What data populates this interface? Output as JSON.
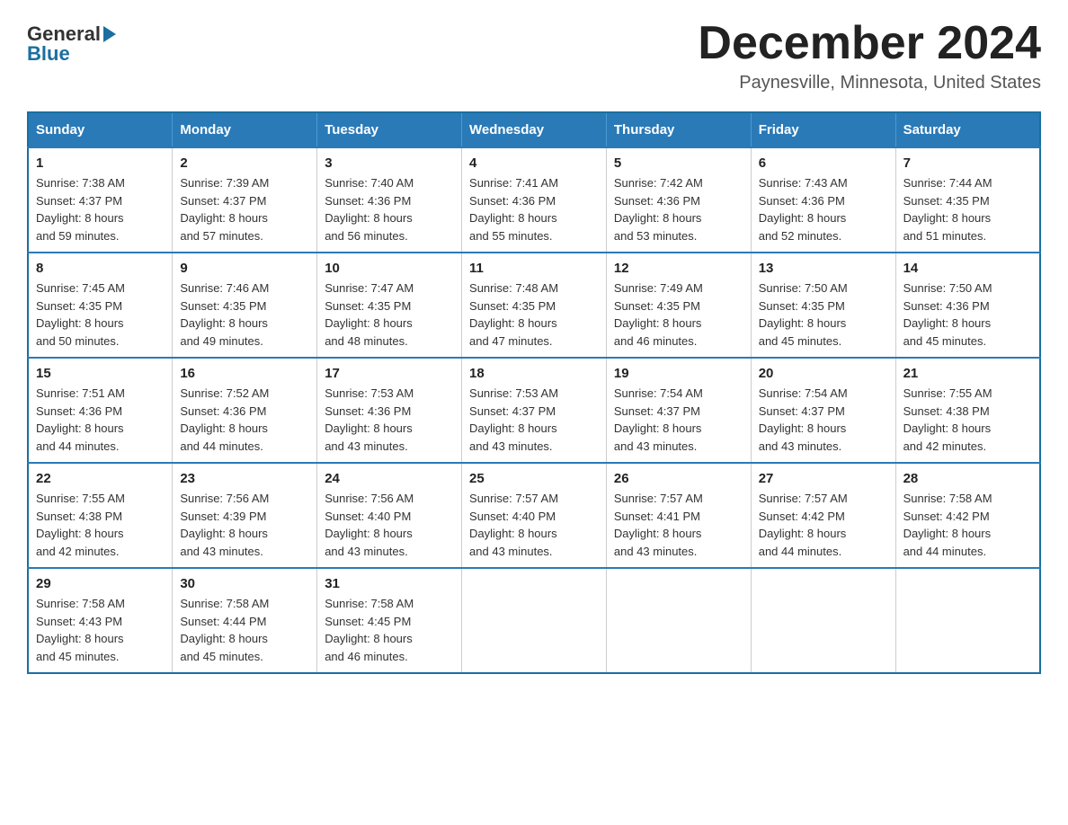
{
  "logo": {
    "general": "General",
    "blue": "Blue"
  },
  "title": "December 2024",
  "subtitle": "Paynesville, Minnesota, United States",
  "days_header": [
    "Sunday",
    "Monday",
    "Tuesday",
    "Wednesday",
    "Thursday",
    "Friday",
    "Saturday"
  ],
  "weeks": [
    [
      {
        "num": "1",
        "sunrise": "7:38 AM",
        "sunset": "4:37 PM",
        "daylight": "8 hours and 59 minutes."
      },
      {
        "num": "2",
        "sunrise": "7:39 AM",
        "sunset": "4:37 PM",
        "daylight": "8 hours and 57 minutes."
      },
      {
        "num": "3",
        "sunrise": "7:40 AM",
        "sunset": "4:36 PM",
        "daylight": "8 hours and 56 minutes."
      },
      {
        "num": "4",
        "sunrise": "7:41 AM",
        "sunset": "4:36 PM",
        "daylight": "8 hours and 55 minutes."
      },
      {
        "num": "5",
        "sunrise": "7:42 AM",
        "sunset": "4:36 PM",
        "daylight": "8 hours and 53 minutes."
      },
      {
        "num": "6",
        "sunrise": "7:43 AM",
        "sunset": "4:36 PM",
        "daylight": "8 hours and 52 minutes."
      },
      {
        "num": "7",
        "sunrise": "7:44 AM",
        "sunset": "4:35 PM",
        "daylight": "8 hours and 51 minutes."
      }
    ],
    [
      {
        "num": "8",
        "sunrise": "7:45 AM",
        "sunset": "4:35 PM",
        "daylight": "8 hours and 50 minutes."
      },
      {
        "num": "9",
        "sunrise": "7:46 AM",
        "sunset": "4:35 PM",
        "daylight": "8 hours and 49 minutes."
      },
      {
        "num": "10",
        "sunrise": "7:47 AM",
        "sunset": "4:35 PM",
        "daylight": "8 hours and 48 minutes."
      },
      {
        "num": "11",
        "sunrise": "7:48 AM",
        "sunset": "4:35 PM",
        "daylight": "8 hours and 47 minutes."
      },
      {
        "num": "12",
        "sunrise": "7:49 AM",
        "sunset": "4:35 PM",
        "daylight": "8 hours and 46 minutes."
      },
      {
        "num": "13",
        "sunrise": "7:50 AM",
        "sunset": "4:35 PM",
        "daylight": "8 hours and 45 minutes."
      },
      {
        "num": "14",
        "sunrise": "7:50 AM",
        "sunset": "4:36 PM",
        "daylight": "8 hours and 45 minutes."
      }
    ],
    [
      {
        "num": "15",
        "sunrise": "7:51 AM",
        "sunset": "4:36 PM",
        "daylight": "8 hours and 44 minutes."
      },
      {
        "num": "16",
        "sunrise": "7:52 AM",
        "sunset": "4:36 PM",
        "daylight": "8 hours and 44 minutes."
      },
      {
        "num": "17",
        "sunrise": "7:53 AM",
        "sunset": "4:36 PM",
        "daylight": "8 hours and 43 minutes."
      },
      {
        "num": "18",
        "sunrise": "7:53 AM",
        "sunset": "4:37 PM",
        "daylight": "8 hours and 43 minutes."
      },
      {
        "num": "19",
        "sunrise": "7:54 AM",
        "sunset": "4:37 PM",
        "daylight": "8 hours and 43 minutes."
      },
      {
        "num": "20",
        "sunrise": "7:54 AM",
        "sunset": "4:37 PM",
        "daylight": "8 hours and 43 minutes."
      },
      {
        "num": "21",
        "sunrise": "7:55 AM",
        "sunset": "4:38 PM",
        "daylight": "8 hours and 42 minutes."
      }
    ],
    [
      {
        "num": "22",
        "sunrise": "7:55 AM",
        "sunset": "4:38 PM",
        "daylight": "8 hours and 42 minutes."
      },
      {
        "num": "23",
        "sunrise": "7:56 AM",
        "sunset": "4:39 PM",
        "daylight": "8 hours and 43 minutes."
      },
      {
        "num": "24",
        "sunrise": "7:56 AM",
        "sunset": "4:40 PM",
        "daylight": "8 hours and 43 minutes."
      },
      {
        "num": "25",
        "sunrise": "7:57 AM",
        "sunset": "4:40 PM",
        "daylight": "8 hours and 43 minutes."
      },
      {
        "num": "26",
        "sunrise": "7:57 AM",
        "sunset": "4:41 PM",
        "daylight": "8 hours and 43 minutes."
      },
      {
        "num": "27",
        "sunrise": "7:57 AM",
        "sunset": "4:42 PM",
        "daylight": "8 hours and 44 minutes."
      },
      {
        "num": "28",
        "sunrise": "7:58 AM",
        "sunset": "4:42 PM",
        "daylight": "8 hours and 44 minutes."
      }
    ],
    [
      {
        "num": "29",
        "sunrise": "7:58 AM",
        "sunset": "4:43 PM",
        "daylight": "8 hours and 45 minutes."
      },
      {
        "num": "30",
        "sunrise": "7:58 AM",
        "sunset": "4:44 PM",
        "daylight": "8 hours and 45 minutes."
      },
      {
        "num": "31",
        "sunrise": "7:58 AM",
        "sunset": "4:45 PM",
        "daylight": "8 hours and 46 minutes."
      },
      null,
      null,
      null,
      null
    ]
  ],
  "labels": {
    "sunrise": "Sunrise:",
    "sunset": "Sunset:",
    "daylight": "Daylight:"
  }
}
